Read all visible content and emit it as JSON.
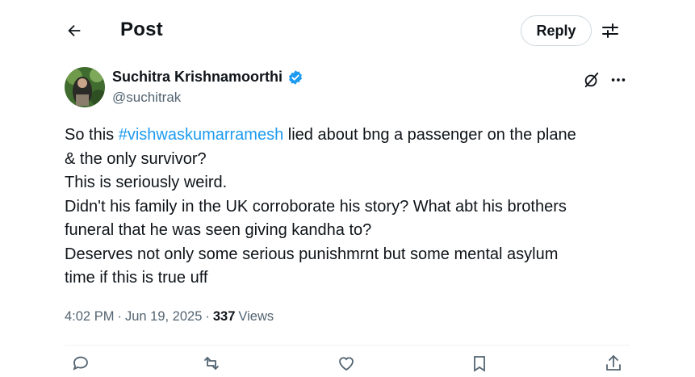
{
  "header": {
    "title": "Post",
    "reply_label": "Reply",
    "back_icon": "arrow-left-icon",
    "settings_icon": "sliders-icon"
  },
  "author": {
    "name": "Suchitra Krishnamoorthi",
    "handle": "@suchitrak",
    "verified": true,
    "verified_color": "#1d9bf0"
  },
  "post": {
    "line1_prefix": "So this ",
    "hashtag": "#vishwaskumarramesh",
    "line1_suffix": " lied about bng a passenger on the plane",
    "line2": "& the only survivor?",
    "line3": "This is seriously weird.",
    "line4": "Didn't his family in the UK corroborate his story? What abt his brothers",
    "line5": "funeral that he was seen giving kandha to?",
    "line6": "Deserves not only some serious punishmrnt but some mental asylum",
    "line7": "time if this is true uff"
  },
  "meta": {
    "time": "4:02 PM",
    "date": "Jun 19, 2025",
    "separator": "·",
    "views_count": "337",
    "views_label": "Views"
  },
  "colors": {
    "link": "#1d9bf0",
    "secondary_text": "#536471",
    "primary_text": "#0f1419"
  }
}
